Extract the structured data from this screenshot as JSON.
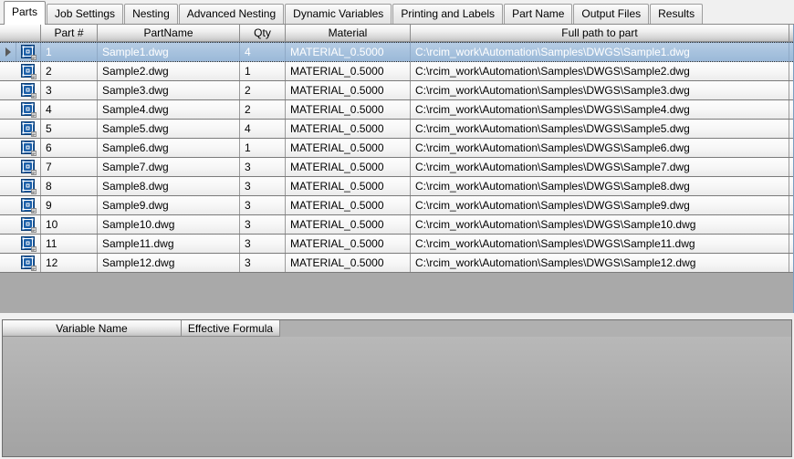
{
  "tabs": [
    {
      "label": "Parts",
      "active": true
    },
    {
      "label": "Job Settings",
      "active": false
    },
    {
      "label": "Nesting",
      "active": false
    },
    {
      "label": "Advanced Nesting",
      "active": false
    },
    {
      "label": "Dynamic Variables",
      "active": false
    },
    {
      "label": "Printing and Labels",
      "active": false
    },
    {
      "label": "Part Name",
      "active": false
    },
    {
      "label": "Output Files",
      "active": false
    },
    {
      "label": "Results",
      "active": false
    }
  ],
  "parts_grid": {
    "columns": {
      "row_indicator": "",
      "icon": "",
      "part_number": "Part #",
      "part_name": "PartName",
      "qty": "Qty",
      "material": "Material",
      "full_path": "Full path to part"
    },
    "row_icon_name": "cad-part-icon",
    "selected_row_index": 0,
    "rows": [
      {
        "part_number": "1",
        "part_name": "Sample1.dwg",
        "qty": "4",
        "material": "MATERIAL_0.5000",
        "full_path": "C:\\rcim_work\\Automation\\Samples\\DWGS\\Sample1.dwg"
      },
      {
        "part_number": "2",
        "part_name": "Sample2.dwg",
        "qty": "1",
        "material": "MATERIAL_0.5000",
        "full_path": "C:\\rcim_work\\Automation\\Samples\\DWGS\\Sample2.dwg"
      },
      {
        "part_number": "3",
        "part_name": "Sample3.dwg",
        "qty": "2",
        "material": "MATERIAL_0.5000",
        "full_path": "C:\\rcim_work\\Automation\\Samples\\DWGS\\Sample3.dwg"
      },
      {
        "part_number": "4",
        "part_name": "Sample4.dwg",
        "qty": "2",
        "material": "MATERIAL_0.5000",
        "full_path": "C:\\rcim_work\\Automation\\Samples\\DWGS\\Sample4.dwg"
      },
      {
        "part_number": "5",
        "part_name": "Sample5.dwg",
        "qty": "4",
        "material": "MATERIAL_0.5000",
        "full_path": "C:\\rcim_work\\Automation\\Samples\\DWGS\\Sample5.dwg"
      },
      {
        "part_number": "6",
        "part_name": "Sample6.dwg",
        "qty": "1",
        "material": "MATERIAL_0.5000",
        "full_path": "C:\\rcim_work\\Automation\\Samples\\DWGS\\Sample6.dwg"
      },
      {
        "part_number": "7",
        "part_name": "Sample7.dwg",
        "qty": "3",
        "material": "MATERIAL_0.5000",
        "full_path": "C:\\rcim_work\\Automation\\Samples\\DWGS\\Sample7.dwg"
      },
      {
        "part_number": "8",
        "part_name": "Sample8.dwg",
        "qty": "3",
        "material": "MATERIAL_0.5000",
        "full_path": "C:\\rcim_work\\Automation\\Samples\\DWGS\\Sample8.dwg"
      },
      {
        "part_number": "9",
        "part_name": "Sample9.dwg",
        "qty": "3",
        "material": "MATERIAL_0.5000",
        "full_path": "C:\\rcim_work\\Automation\\Samples\\DWGS\\Sample9.dwg"
      },
      {
        "part_number": "10",
        "part_name": "Sample10.dwg",
        "qty": "3",
        "material": "MATERIAL_0.5000",
        "full_path": "C:\\rcim_work\\Automation\\Samples\\DWGS\\Sample10.dwg"
      },
      {
        "part_number": "11",
        "part_name": "Sample11.dwg",
        "qty": "3",
        "material": "MATERIAL_0.5000",
        "full_path": "C:\\rcim_work\\Automation\\Samples\\DWGS\\Sample11.dwg"
      },
      {
        "part_number": "12",
        "part_name": "Sample12.dwg",
        "qty": "3",
        "material": "MATERIAL_0.5000",
        "full_path": "C:\\rcim_work\\Automation\\Samples\\DWGS\\Sample12.dwg"
      }
    ]
  },
  "variables_grid": {
    "columns": {
      "variable_name": "Variable Name",
      "effective_formula": "Effective Formula"
    },
    "rows": []
  },
  "colors": {
    "selection_blue": "#a7c2de",
    "selection_text": "#ffffff",
    "grid_background": "#a9a9a9",
    "panel_background": "#f0f0f0",
    "icon_blue": "#1b5fa8"
  }
}
